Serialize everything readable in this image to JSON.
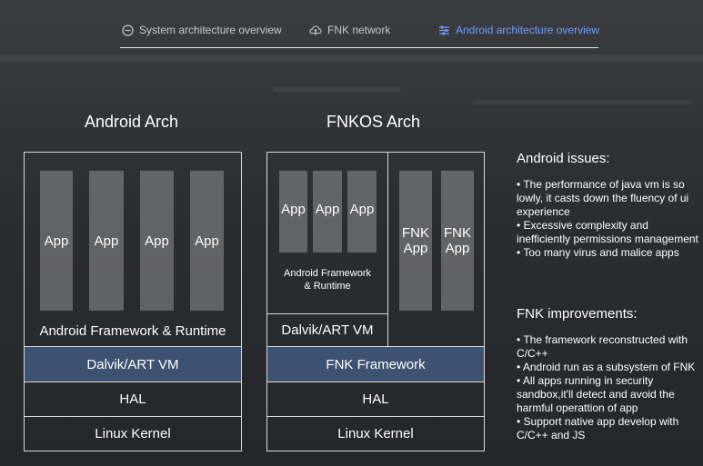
{
  "tabs": [
    {
      "label": "System architecture overview",
      "icon": "minus-circle-icon",
      "active": false
    },
    {
      "label": "FNK network",
      "icon": "cloud-network-icon",
      "active": false
    },
    {
      "label": "Android architecture overview",
      "icon": "sliders-icon",
      "active": true
    }
  ],
  "android": {
    "title": "Android Arch",
    "apps": [
      "App",
      "App",
      "App",
      "App"
    ],
    "framework": "Android Framework & Runtime",
    "vm": "Dalvik/ART VM",
    "hal": "HAL",
    "kernel": "Linux Kernel"
  },
  "fnkos": {
    "title": "FNKOS Arch",
    "apps": [
      "App",
      "App",
      "App"
    ],
    "framework_runtime": "Android Framework\n& Runtime",
    "vm": "Dalvik/ART VM",
    "fnk_apps": [
      "FNK\nApp",
      "FNK\nApp"
    ],
    "fnk_framework": "FNK Framework",
    "hal": "HAL",
    "kernel": "Linux Kernel"
  },
  "issues": {
    "title": "Android issues:",
    "items": [
      "• The performance of java vm is so lowly, it casts down the fluency of ui experience",
      "• Excessive complexity and inefficiently permissions management",
      "• Too many virus and malice apps"
    ]
  },
  "improvements": {
    "title": "FNK improvements:",
    "items": [
      "• The framework reconstructed with C/C++",
      "• Android run as a subsystem of FNK",
      "• All apps running in security sandbox,it'll detect and avoid the harmful operattion of app",
      "• Support native app develop with C/C++ and JS"
    ]
  },
  "colors": {
    "accent": "#6fa0ff",
    "highlight_layer": "#3d5270",
    "border": "#d9d9d9"
  }
}
